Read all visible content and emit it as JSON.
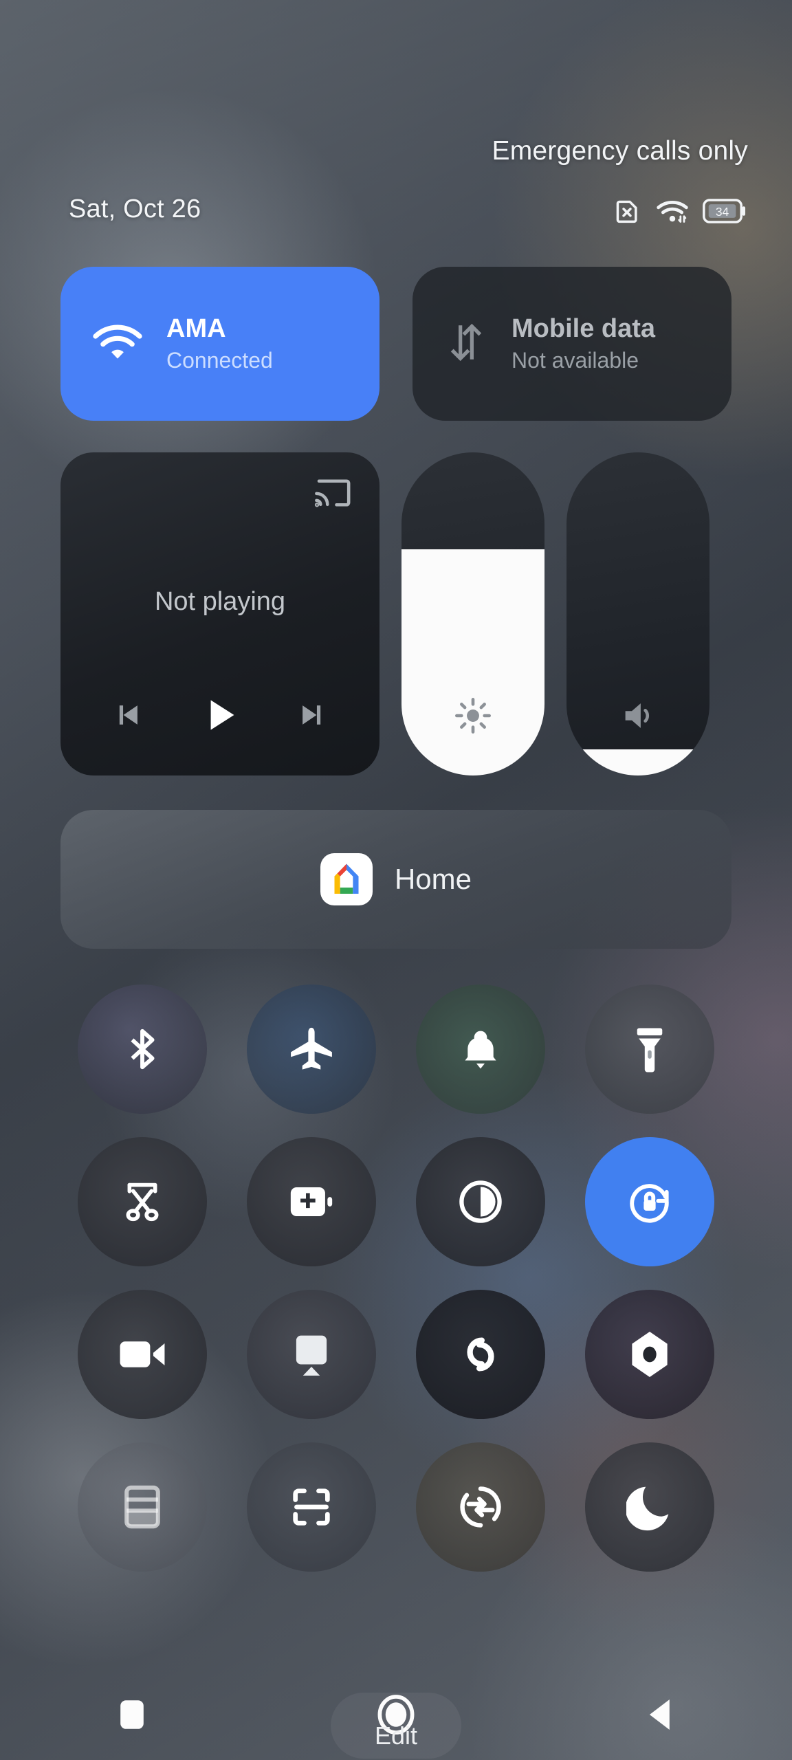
{
  "status": {
    "carrier_text": "Emergency calls only",
    "date": "Sat, Oct 26",
    "battery_level": "34",
    "icons": [
      "sim-off-icon",
      "wifi-icon",
      "battery-icon"
    ]
  },
  "connectivity": [
    {
      "icon": "wifi-icon",
      "title": "AMA",
      "subtitle": "Connected",
      "state": "on",
      "color": "#4880f7"
    },
    {
      "icon": "mobile-data-icon",
      "title": "Mobile data",
      "subtitle": "Not available",
      "state": "off"
    }
  ],
  "media": {
    "cast_icon": "cast-icon",
    "title": "Not playing",
    "controls": [
      "previous-track-icon",
      "play-icon",
      "next-track-icon"
    ]
  },
  "sliders": [
    {
      "name": "brightness",
      "icon": "brightness-icon",
      "value_percent": 70,
      "fill_color": "#fbfbfb"
    },
    {
      "name": "volume",
      "icon": "volume-icon",
      "value_percent": 8,
      "fill_color": "#fbfbfb"
    }
  ],
  "home_control": {
    "icon": "google-home-icon",
    "label": "Home"
  },
  "quick_settings": [
    {
      "icon": "bluetooth-icon",
      "label": "Bluetooth",
      "active": false
    },
    {
      "icon": "airplane-icon",
      "label": "Airplane mode",
      "active": false
    },
    {
      "icon": "bell-icon",
      "label": "Ring",
      "active": false
    },
    {
      "icon": "flashlight-icon",
      "label": "Flashlight",
      "active": false
    },
    {
      "icon": "screenshot-icon",
      "label": "Screenshot",
      "active": false
    },
    {
      "icon": "battery-saver-icon",
      "label": "Battery Saver",
      "active": false
    },
    {
      "icon": "dark-theme-icon",
      "label": "Dark theme",
      "active": false
    },
    {
      "icon": "auto-rotate-lock-icon",
      "label": "Auto-rotate",
      "active": true
    },
    {
      "icon": "screen-record-icon",
      "label": "Screen record",
      "active": false
    },
    {
      "icon": "screen-cast-icon",
      "label": "Screen cast",
      "active": false
    },
    {
      "icon": "nearby-share-icon",
      "label": "Nearby Share",
      "active": false
    },
    {
      "icon": "vpn-icon",
      "label": "VPN",
      "active": false
    },
    {
      "icon": "wallet-icon",
      "label": "Wallet",
      "active": false
    },
    {
      "icon": "qr-scanner-icon",
      "label": "QR scanner",
      "active": false
    },
    {
      "icon": "data-transfer-icon",
      "label": "Data Saver",
      "active": false
    },
    {
      "icon": "bedtime-moon-icon",
      "label": "Bedtime mode",
      "active": false
    }
  ],
  "edit": {
    "label": "Edit"
  },
  "navbar": {
    "recents_icon": "recents-square-icon",
    "home_icon": "home-circle-icon",
    "back_icon": "back-triangle-icon"
  },
  "colors": {
    "accent": "#4880f7",
    "tile_off": "#1f2328",
    "text": "#f2f4f6"
  }
}
